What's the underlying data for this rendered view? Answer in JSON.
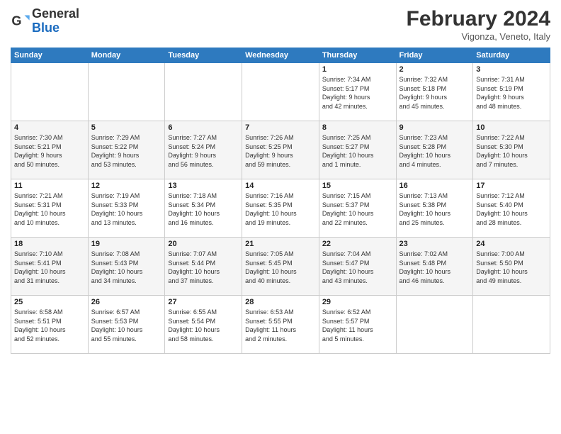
{
  "header": {
    "logo_general": "General",
    "logo_blue": "Blue",
    "month_title": "February 2024",
    "subtitle": "Vigonza, Veneto, Italy"
  },
  "days_of_week": [
    "Sunday",
    "Monday",
    "Tuesday",
    "Wednesday",
    "Thursday",
    "Friday",
    "Saturday"
  ],
  "weeks": [
    [
      {
        "day": "",
        "info": ""
      },
      {
        "day": "",
        "info": ""
      },
      {
        "day": "",
        "info": ""
      },
      {
        "day": "",
        "info": ""
      },
      {
        "day": "1",
        "info": "Sunrise: 7:34 AM\nSunset: 5:17 PM\nDaylight: 9 hours\nand 42 minutes."
      },
      {
        "day": "2",
        "info": "Sunrise: 7:32 AM\nSunset: 5:18 PM\nDaylight: 9 hours\nand 45 minutes."
      },
      {
        "day": "3",
        "info": "Sunrise: 7:31 AM\nSunset: 5:19 PM\nDaylight: 9 hours\nand 48 minutes."
      }
    ],
    [
      {
        "day": "4",
        "info": "Sunrise: 7:30 AM\nSunset: 5:21 PM\nDaylight: 9 hours\nand 50 minutes."
      },
      {
        "day": "5",
        "info": "Sunrise: 7:29 AM\nSunset: 5:22 PM\nDaylight: 9 hours\nand 53 minutes."
      },
      {
        "day": "6",
        "info": "Sunrise: 7:27 AM\nSunset: 5:24 PM\nDaylight: 9 hours\nand 56 minutes."
      },
      {
        "day": "7",
        "info": "Sunrise: 7:26 AM\nSunset: 5:25 PM\nDaylight: 9 hours\nand 59 minutes."
      },
      {
        "day": "8",
        "info": "Sunrise: 7:25 AM\nSunset: 5:27 PM\nDaylight: 10 hours\nand 1 minute."
      },
      {
        "day": "9",
        "info": "Sunrise: 7:23 AM\nSunset: 5:28 PM\nDaylight: 10 hours\nand 4 minutes."
      },
      {
        "day": "10",
        "info": "Sunrise: 7:22 AM\nSunset: 5:30 PM\nDaylight: 10 hours\nand 7 minutes."
      }
    ],
    [
      {
        "day": "11",
        "info": "Sunrise: 7:21 AM\nSunset: 5:31 PM\nDaylight: 10 hours\nand 10 minutes."
      },
      {
        "day": "12",
        "info": "Sunrise: 7:19 AM\nSunset: 5:33 PM\nDaylight: 10 hours\nand 13 minutes."
      },
      {
        "day": "13",
        "info": "Sunrise: 7:18 AM\nSunset: 5:34 PM\nDaylight: 10 hours\nand 16 minutes."
      },
      {
        "day": "14",
        "info": "Sunrise: 7:16 AM\nSunset: 5:35 PM\nDaylight: 10 hours\nand 19 minutes."
      },
      {
        "day": "15",
        "info": "Sunrise: 7:15 AM\nSunset: 5:37 PM\nDaylight: 10 hours\nand 22 minutes."
      },
      {
        "day": "16",
        "info": "Sunrise: 7:13 AM\nSunset: 5:38 PM\nDaylight: 10 hours\nand 25 minutes."
      },
      {
        "day": "17",
        "info": "Sunrise: 7:12 AM\nSunset: 5:40 PM\nDaylight: 10 hours\nand 28 minutes."
      }
    ],
    [
      {
        "day": "18",
        "info": "Sunrise: 7:10 AM\nSunset: 5:41 PM\nDaylight: 10 hours\nand 31 minutes."
      },
      {
        "day": "19",
        "info": "Sunrise: 7:08 AM\nSunset: 5:43 PM\nDaylight: 10 hours\nand 34 minutes."
      },
      {
        "day": "20",
        "info": "Sunrise: 7:07 AM\nSunset: 5:44 PM\nDaylight: 10 hours\nand 37 minutes."
      },
      {
        "day": "21",
        "info": "Sunrise: 7:05 AM\nSunset: 5:45 PM\nDaylight: 10 hours\nand 40 minutes."
      },
      {
        "day": "22",
        "info": "Sunrise: 7:04 AM\nSunset: 5:47 PM\nDaylight: 10 hours\nand 43 minutes."
      },
      {
        "day": "23",
        "info": "Sunrise: 7:02 AM\nSunset: 5:48 PM\nDaylight: 10 hours\nand 46 minutes."
      },
      {
        "day": "24",
        "info": "Sunrise: 7:00 AM\nSunset: 5:50 PM\nDaylight: 10 hours\nand 49 minutes."
      }
    ],
    [
      {
        "day": "25",
        "info": "Sunrise: 6:58 AM\nSunset: 5:51 PM\nDaylight: 10 hours\nand 52 minutes."
      },
      {
        "day": "26",
        "info": "Sunrise: 6:57 AM\nSunset: 5:53 PM\nDaylight: 10 hours\nand 55 minutes."
      },
      {
        "day": "27",
        "info": "Sunrise: 6:55 AM\nSunset: 5:54 PM\nDaylight: 10 hours\nand 58 minutes."
      },
      {
        "day": "28",
        "info": "Sunrise: 6:53 AM\nSunset: 5:55 PM\nDaylight: 11 hours\nand 2 minutes."
      },
      {
        "day": "29",
        "info": "Sunrise: 6:52 AM\nSunset: 5:57 PM\nDaylight: 11 hours\nand 5 minutes."
      },
      {
        "day": "",
        "info": ""
      },
      {
        "day": "",
        "info": ""
      }
    ]
  ]
}
